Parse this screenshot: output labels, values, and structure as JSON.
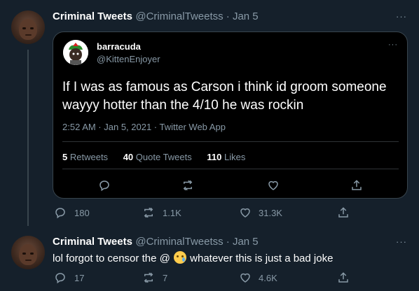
{
  "tweet1": {
    "name": "Criminal Tweets",
    "handle": "@CriminalTweetss · Jan 5",
    "more": "···",
    "quote": {
      "name": "barracuda",
      "handle": "@KittenEnjoyer",
      "more": "···",
      "text": "If I was as famous as Carson i think id groom someone wayyy hotter than the 4/10 he was rockin",
      "meta": "2:52 AM · Jan 5, 2021 · Twitter Web App",
      "retweets_count": "5",
      "retweets_label": "Retweets",
      "quotes_count": "40",
      "quotes_label": "Quote Tweets",
      "likes_count": "110",
      "likes_label": "Likes"
    },
    "actions": {
      "replies": "180",
      "retweets": "1.1K",
      "likes": "31.3K"
    }
  },
  "tweet2": {
    "name": "Criminal Tweets",
    "handle": "@CriminalTweetss · Jan 5",
    "more": "···",
    "text_before": "lol forgot to censor the @",
    "emoji": "face-holding-back-tears-emoji",
    "text_after": "whatever this is just a bad joke",
    "actions": {
      "replies": "17",
      "retweets": "7",
      "likes": "4.6K"
    }
  },
  "colors": {
    "background": "#15202b",
    "quote_background": "#000000",
    "secondary_text": "#8899a6",
    "border": "#38444d"
  }
}
